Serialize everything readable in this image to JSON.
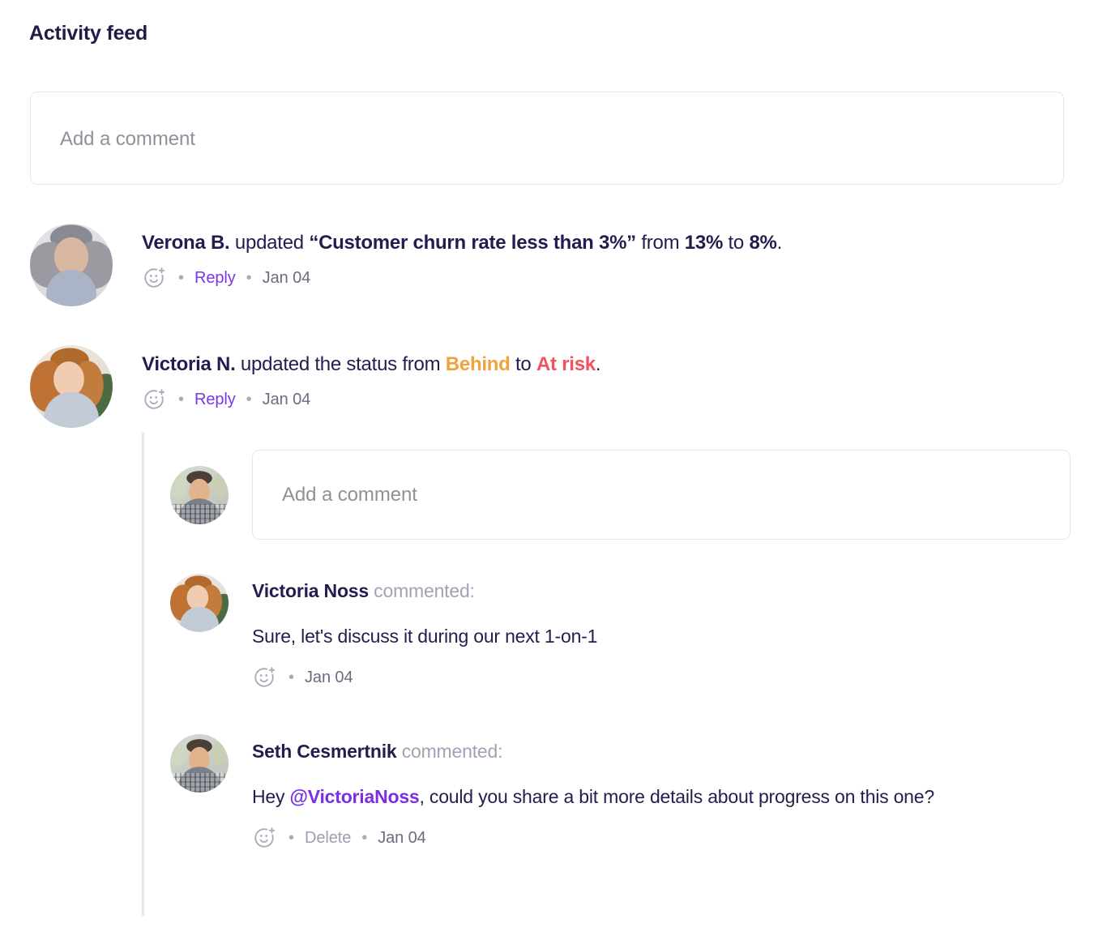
{
  "page": {
    "title": "Activity feed"
  },
  "composer": {
    "placeholder": "Add a comment"
  },
  "icons": {
    "add_reaction": "smiley-plus-icon"
  },
  "separator": "•",
  "activities": [
    {
      "avatar": "verona-avatar",
      "actor": "Verona B.",
      "verb": " updated ",
      "target": "“Customer churn rate less than 3%”",
      "from_label": " from ",
      "from_value": "13%",
      "to_label": " to ",
      "to_value": "8%",
      "end": ".",
      "reply_label": "Reply",
      "date": "Jan 04"
    },
    {
      "avatar": "victoria-avatar",
      "actor": "Victoria N.",
      "verb": " updated the status from ",
      "from_value": "Behind",
      "to_label": " to ",
      "to_value": "At risk",
      "end": ".",
      "reply_label": "Reply",
      "date": "Jan 04"
    }
  ],
  "thread": {
    "composer": {
      "avatar": "seth-avatar",
      "placeholder": "Add a comment"
    },
    "comments": [
      {
        "avatar": "victoria-avatar",
        "author": "Victoria Noss",
        "verb": " commented:",
        "text": "Sure, let's discuss it during our next 1-on-1",
        "date": "Jan 04"
      },
      {
        "avatar": "seth-avatar",
        "author": "Seth Cesmertnik",
        "verb": " commented:",
        "text_before": "Hey ",
        "mention": "@VictoriaNoss",
        "text_after": ", could you share a bit more details about progress on this one?",
        "delete_label": "Delete",
        "date": "Jan 04"
      }
    ]
  },
  "colors": {
    "title": "#211b45",
    "text": "#231d4f",
    "muted": "#8e9199",
    "link": "#7b35e8",
    "mention": "#7b2fe0",
    "status_behind": "#f2a13c",
    "status_at_risk": "#f5505f",
    "border": "#e6e7eb",
    "thread_line": "#e8e8ea"
  }
}
